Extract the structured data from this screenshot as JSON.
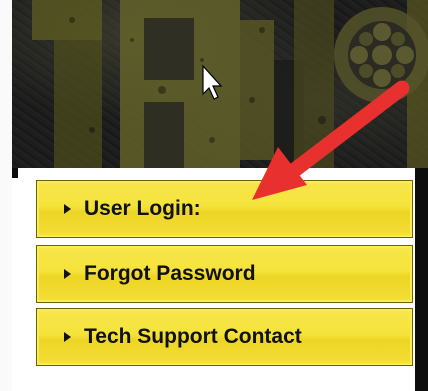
{
  "menu": {
    "items": [
      {
        "label": "User Login:"
      },
      {
        "label": "Forgot Password"
      },
      {
        "label": "Tech Support Contact"
      }
    ]
  },
  "colors": {
    "button_fill": "#f5e33c",
    "banner_dark": "#1a1a1a",
    "logo_olive": "#6b6a2a",
    "annotation_arrow": "#e8312f"
  },
  "icons": {
    "menu_item": "triangle-right-icon",
    "banner_emblem": "wheel-emblem-icon",
    "pointer": "mouse-cursor-icon",
    "annotation": "red-arrow-icon"
  }
}
